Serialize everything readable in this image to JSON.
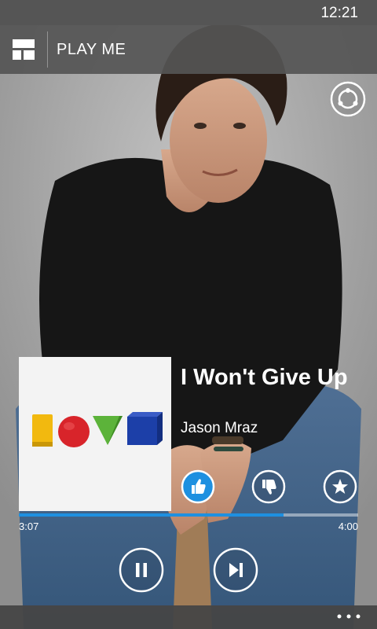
{
  "status_bar": {
    "time": "12:21"
  },
  "header": {
    "title": "PLAY ME",
    "menu_icon": "layout-grid-icon"
  },
  "share": {
    "icon": "share-icon"
  },
  "now_playing": {
    "title": "I Won't Give Up",
    "artist": "Jason Mraz",
    "album_art": "love-album-art"
  },
  "rating": {
    "thumbs_up_icon": "thumbs-up-icon",
    "thumbs_up_active": true,
    "thumbs_down_icon": "thumbs-down-icon",
    "star_icon": "star-icon"
  },
  "progress": {
    "elapsed": "3:07",
    "total": "4:00",
    "fraction": 0.78
  },
  "controls": {
    "pause_icon": "pause-icon",
    "next_icon": "skip-next-icon"
  },
  "app_bar": {
    "more_icon": "more-dots-icon"
  },
  "colors": {
    "accent": "#1e90e0",
    "status_bar": "#555555",
    "header": "#555555",
    "album_yellow": "#f2b90f",
    "album_red": "#d8242a",
    "album_green": "#5cb33a",
    "album_blue": "#1c3fa8"
  }
}
